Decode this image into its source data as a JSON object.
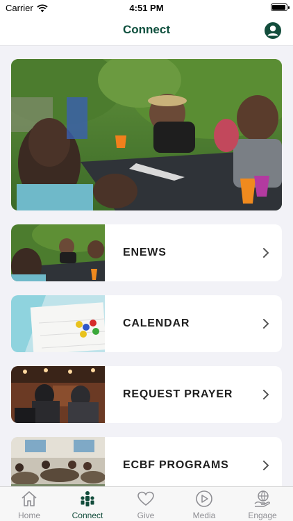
{
  "status_bar": {
    "carrier": "Carrier",
    "time": "4:51 PM"
  },
  "header": {
    "title": "Connect"
  },
  "cards": [
    {
      "label": "ENEWS"
    },
    {
      "label": "CALENDAR"
    },
    {
      "label": "REQUEST PRAYER"
    },
    {
      "label": "ECBF PROGRAMS"
    }
  ],
  "tabs": [
    {
      "label": "Home",
      "icon": "house-icon",
      "active": false
    },
    {
      "label": "Connect",
      "icon": "people-icon",
      "active": true
    },
    {
      "label": "Give",
      "icon": "heart-icon",
      "active": false
    },
    {
      "label": "Media",
      "icon": "play-icon",
      "active": false
    },
    {
      "label": "Engage",
      "icon": "globe-hand-icon",
      "active": false
    }
  ],
  "colors": {
    "brand_green": "#134d3c",
    "title_green": "#0e4f3d",
    "inactive_tab": "#8e8e93",
    "background": "#f2f2f7"
  }
}
